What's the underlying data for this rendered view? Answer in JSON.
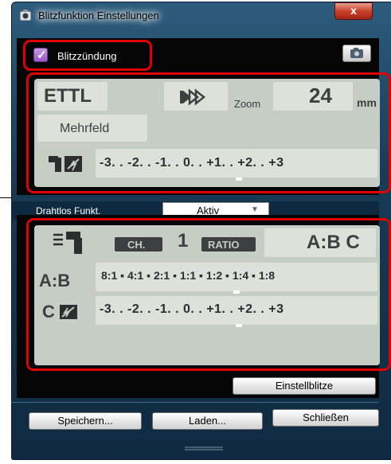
{
  "window": {
    "title": "Blitzfunktion Einstellungen",
    "close_glyph": "x"
  },
  "flash": {
    "checkbox_label": "Blitzzündung",
    "checked": true
  },
  "mode_panel": {
    "mode": "ETTL",
    "zoom_label": "Zoom",
    "zoom_value": "24",
    "zoom_unit": "mm",
    "metering": "Mehrfeld",
    "fec_scale": "-3. . -2. . -1. . 0. . +1. . +2. . +3"
  },
  "wireless": {
    "label": "Drahtlos Funkt.",
    "selected": "Aktiv",
    "channel_label": "CH.",
    "channel": "1",
    "ratio_label": "RATIO",
    "ratio_mode": "A:B C",
    "ab_label": "A:B",
    "ab_scale": "8:1 ▪ 4:1 ▪ 2:1 ▪ 1:1 ▪ 1:2 ▪ 1:4 ▪ 1:8",
    "c_label": "C",
    "c_scale": "-3. . -2. . -1. . 0. . +1. . +2. . +3"
  },
  "buttons": {
    "einstellblitze": "Einstellblitze",
    "save": "Speichern...",
    "load": "Laden...",
    "close": "Schließen"
  },
  "colors": {
    "highlight": "#e00000",
    "lcd": "#c6cdc5",
    "checkbox": "#9a55c9"
  }
}
